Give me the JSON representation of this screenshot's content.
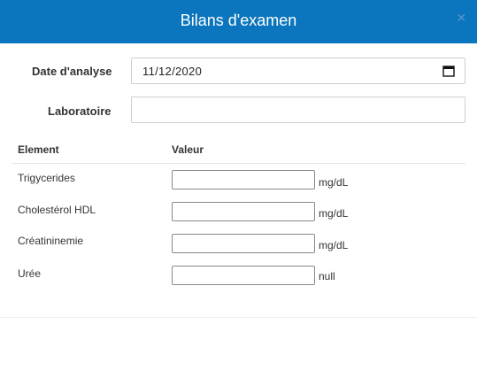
{
  "dialog": {
    "title": "Bilans d'examen",
    "close_glyph": "×"
  },
  "form": {
    "date_label": "Date d'analyse",
    "date_value": "11/12/2020",
    "lab_label": "Laboratoire",
    "lab_value": ""
  },
  "table": {
    "headers": {
      "element": "Element",
      "value": "Valeur"
    },
    "rows": [
      {
        "element": "Trigycerides",
        "value": "",
        "unit": "mg/dL"
      },
      {
        "element": "Cholestérol HDL",
        "value": "",
        "unit": "mg/dL"
      },
      {
        "element": "Créatininemie",
        "value": "",
        "unit": "mg/dL"
      },
      {
        "element": "Urée",
        "value": "",
        "unit": "null"
      }
    ]
  },
  "colors": {
    "header_bg": "#0b76bd",
    "header_text": "#ffffff"
  }
}
